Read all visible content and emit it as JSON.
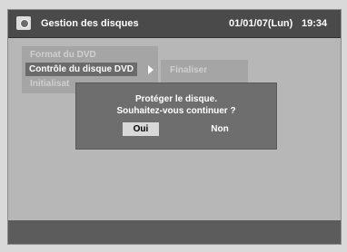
{
  "header": {
    "title": "Gestion des disques",
    "date": "01/01/07(Lun)",
    "time": "19:34",
    "icon": "disc-icon"
  },
  "menu": {
    "items": [
      {
        "label": "Format du DVD"
      },
      {
        "label": "Contrôle du disque DVD"
      },
      {
        "label": "Initialisat"
      }
    ]
  },
  "submenu": {
    "items": [
      {
        "label": "Finaliser"
      }
    ]
  },
  "dialog": {
    "line1": "Protéger le disque.",
    "line2": "Souhaitez-vous continuer ?",
    "yes_label": "Oui",
    "no_label": "Non"
  }
}
